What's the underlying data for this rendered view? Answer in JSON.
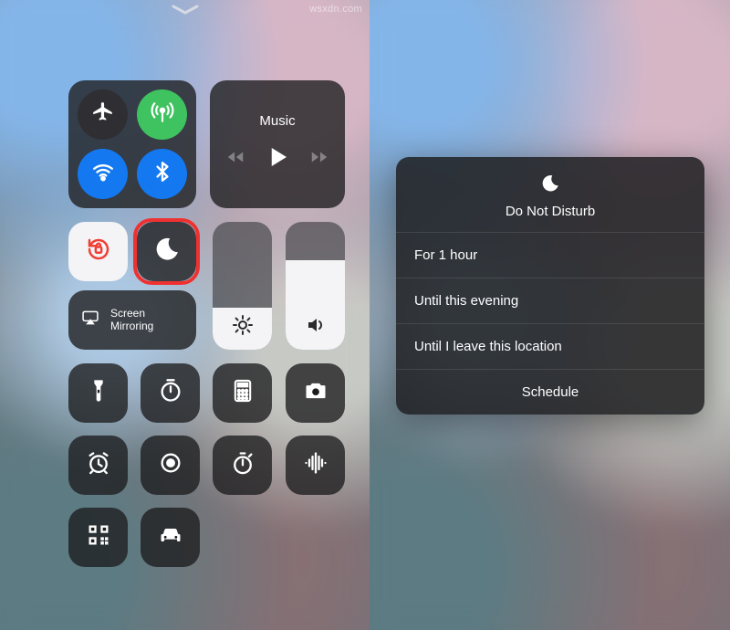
{
  "watermark": "wsxdn.com",
  "left": {
    "music": {
      "title": "Music"
    },
    "mirror": {
      "line1": "Screen",
      "line2": "Mirroring"
    },
    "brightness_pct": 33,
    "volume_pct": 70
  },
  "right": {
    "dnd_popup": {
      "title": "Do Not Disturb",
      "options": [
        "For 1 hour",
        "Until this evening",
        "Until I leave this location"
      ],
      "schedule": "Schedule"
    }
  },
  "icons": {
    "airplane": "airplane-icon",
    "cellular": "antenna-icon",
    "wifi": "wifi-icon",
    "bluetooth": "bluetooth-icon",
    "orientation_lock": "rotation-lock-icon",
    "moon": "moon-icon",
    "airplay": "airplay-icon",
    "brightness": "sun-icon",
    "volume": "speaker-icon",
    "flashlight": "flashlight-icon",
    "timer": "timer-icon",
    "calculator": "calculator-icon",
    "camera": "camera-icon",
    "alarm": "alarm-clock-icon",
    "screen_record": "screen-record-icon",
    "stopwatch": "stopwatch-icon",
    "voice_memo": "waveform-icon",
    "qr": "qr-code-icon",
    "car": "car-icon",
    "prev": "rewind-icon",
    "play": "play-icon",
    "next": "fastforward-icon"
  }
}
